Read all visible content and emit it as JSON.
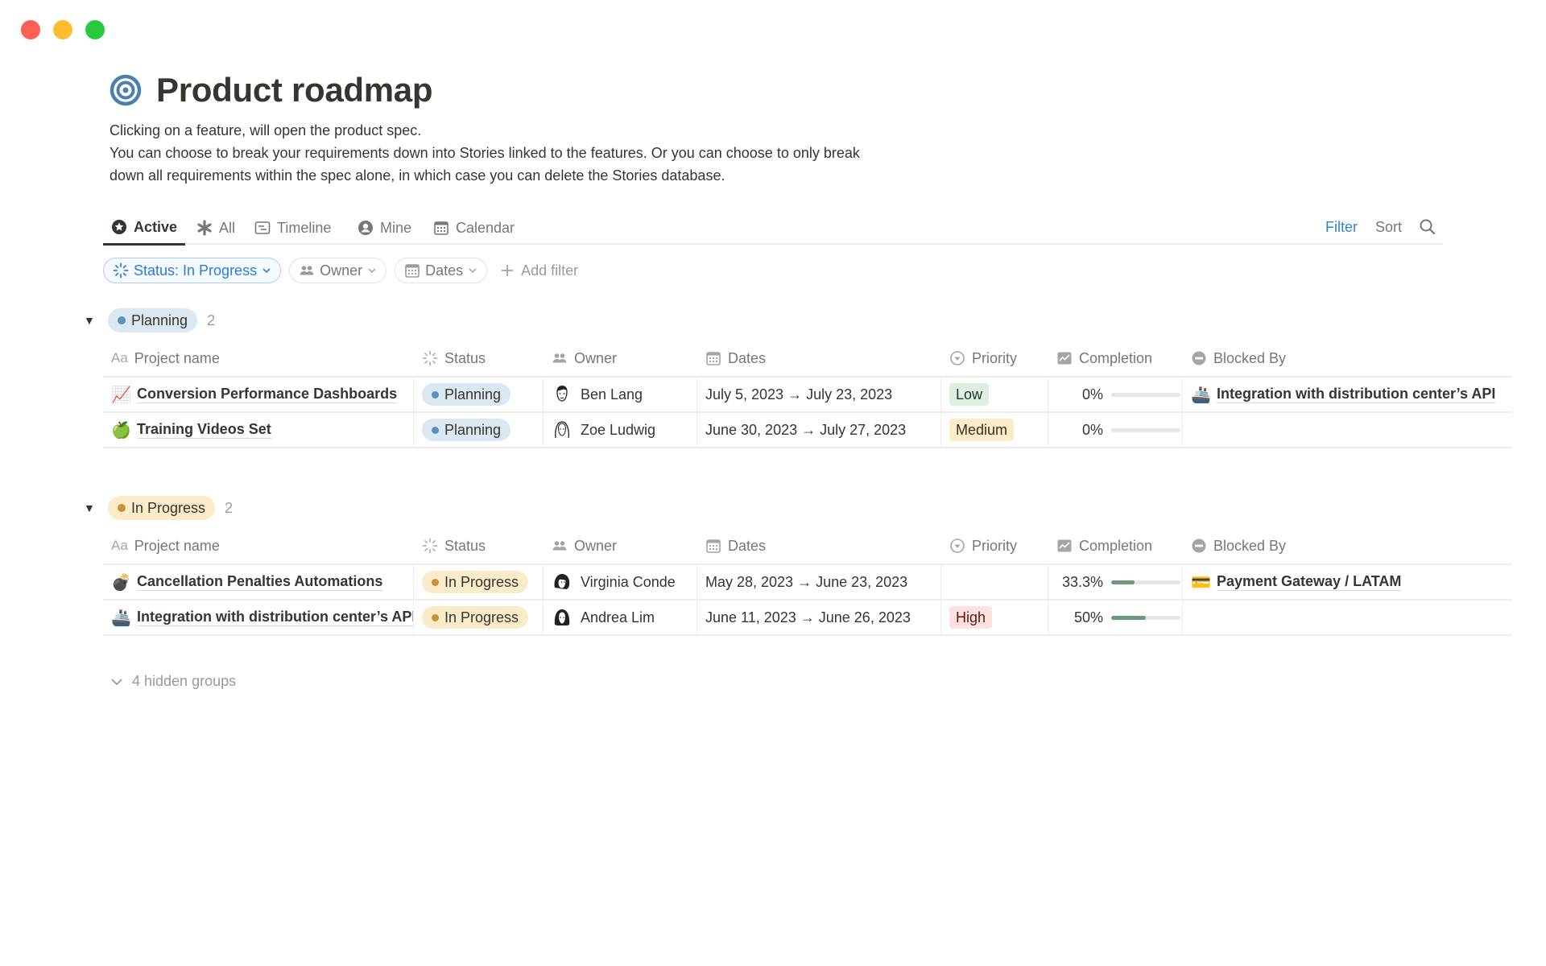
{
  "window": {
    "controls": [
      "close",
      "minimize",
      "maximize"
    ]
  },
  "page": {
    "icon": "target-icon",
    "title": "Product roadmap",
    "description": [
      "Clicking on a feature, will open the product spec.",
      "You can choose to break your requirements down into Stories linked to the features. Or you can choose to only break",
      "down all requirements within the spec alone, in which case you can delete the Stories database."
    ]
  },
  "tabs": [
    {
      "label": "Active",
      "icon": "star-circle-icon",
      "active": true
    },
    {
      "label": "All",
      "icon": "asterisk-icon",
      "active": false
    },
    {
      "label": "Timeline",
      "icon": "timeline-icon",
      "active": false
    },
    {
      "label": "Mine",
      "icon": "person-circle-icon",
      "active": false
    },
    {
      "label": "Calendar",
      "icon": "calendar-icon",
      "active": false
    }
  ],
  "toolbar": {
    "filter_label": "Filter",
    "sort_label": "Sort",
    "search_icon": "search-icon"
  },
  "filters": {
    "status": "Status: In Progress",
    "owner": "Owner",
    "dates": "Dates",
    "add_filter": "Add filter"
  },
  "columns": {
    "name": "Project name",
    "name_icon_text": "Aa",
    "status": "Status",
    "owner": "Owner",
    "dates": "Dates",
    "priority": "Priority",
    "completion": "Completion",
    "blocked_by": "Blocked By"
  },
  "colors": {
    "planning_bg": "#dbe7f1",
    "planning_dot": "#5f8fbf",
    "progress_bg": "#faecc8",
    "progress_dot": "#c8923b",
    "low_bg": "#dfeee2",
    "medium_bg": "#fbedc9",
    "high_bg": "#fbe1df",
    "high_text": "#5d1715",
    "bar_fill": "#6c9a7a",
    "accent": "#2f80d6"
  },
  "groups": [
    {
      "label": "Planning",
      "count": "2",
      "rows": [
        {
          "emoji": "📈",
          "name": "Conversion Performance Dashboards",
          "status": "Planning",
          "owner": "Ben Lang",
          "dates": "July 5, 2023 → July 23, 2023",
          "priority": "Low",
          "completion_text": "0%",
          "completion": 0,
          "blocked_emoji": "🚢",
          "blocked_by": "Integration with distribution center’s API"
        },
        {
          "emoji": "🍏",
          "name": "Training Videos Set",
          "status": "Planning",
          "owner": "Zoe Ludwig",
          "dates": "June 30, 2023 → July 27, 2023",
          "priority": "Medium",
          "completion_text": "0%",
          "completion": 0,
          "blocked_emoji": "",
          "blocked_by": ""
        }
      ]
    },
    {
      "label": "In Progress",
      "count": "2",
      "rows": [
        {
          "emoji": "💣",
          "name": "Cancellation Penalties Automations",
          "status": "In Progress",
          "owner": "Virginia Conde",
          "dates": "May 28, 2023 → June 23, 2023",
          "priority": "",
          "completion_text": "33.3%",
          "completion": 0.333,
          "blocked_emoji": "💳",
          "blocked_by": "Payment Gateway / LATAM"
        },
        {
          "emoji": "🚢",
          "name": "Integration with distribution center’s API",
          "status": "In Progress",
          "owner": "Andrea Lim",
          "dates": "June 11, 2023 → June 26, 2023",
          "priority": "High",
          "completion_text": "50%",
          "completion": 0.5,
          "blocked_emoji": "",
          "blocked_by": ""
        }
      ]
    }
  ],
  "hidden_groups": "4 hidden groups"
}
